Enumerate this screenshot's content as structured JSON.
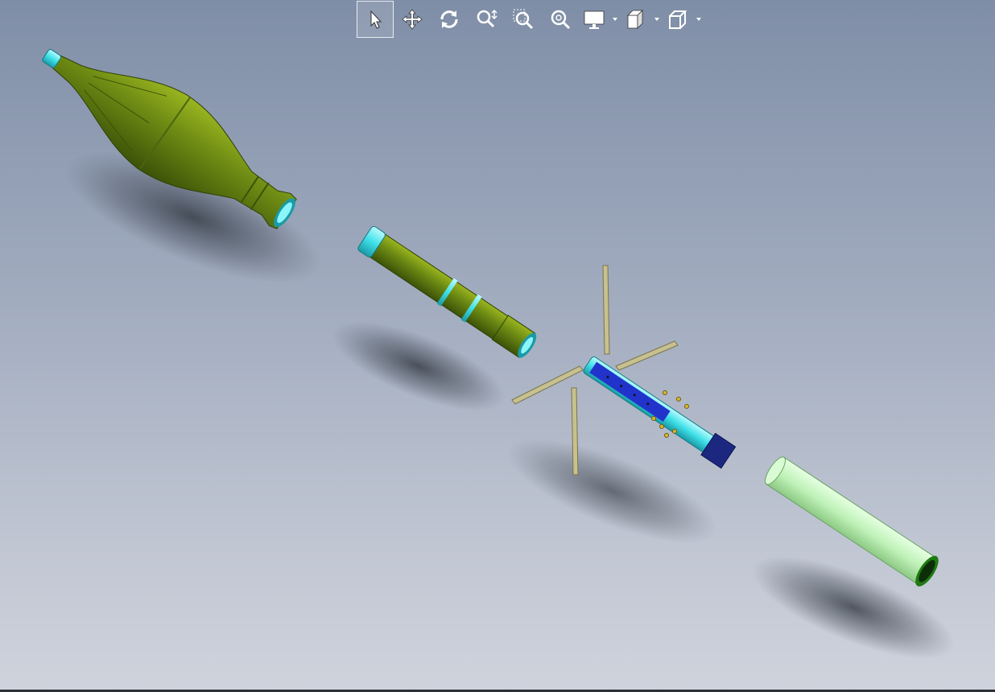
{
  "colors": {
    "olive": "#6b8a14",
    "cyan": "#3ee0e8",
    "blue": "#2233cc",
    "khaki": "#c7c08f",
    "light_green": "#bff2b8",
    "dark_green": "#1f7a12"
  },
  "toolbar": {
    "buttons": [
      {
        "name": "select-tool",
        "icon": "cursor-arrow-icon",
        "active": true
      },
      {
        "name": "pan-tool",
        "icon": "move-arrows-icon"
      },
      {
        "name": "rotate-tool",
        "icon": "rotate-icon"
      },
      {
        "name": "zoom-in-out-tool",
        "icon": "zoom-in-out-icon"
      },
      {
        "name": "zoom-to-area-tool",
        "icon": "zoom-area-icon"
      },
      {
        "name": "zoom-to-fit-tool",
        "icon": "zoom-fit-icon"
      },
      {
        "name": "display-style-dropdown",
        "icon": "monitor-icon",
        "has_menu": true
      },
      {
        "name": "view-settings-dropdown",
        "icon": "view-cube-icon",
        "has_menu": true
      },
      {
        "name": "view-orientation-dropdown",
        "icon": "cube-outline-icon",
        "has_menu": true
      }
    ]
  },
  "model": {
    "parts": [
      "warhead",
      "body-tube",
      "fin-assembly",
      "motor-tube"
    ]
  }
}
